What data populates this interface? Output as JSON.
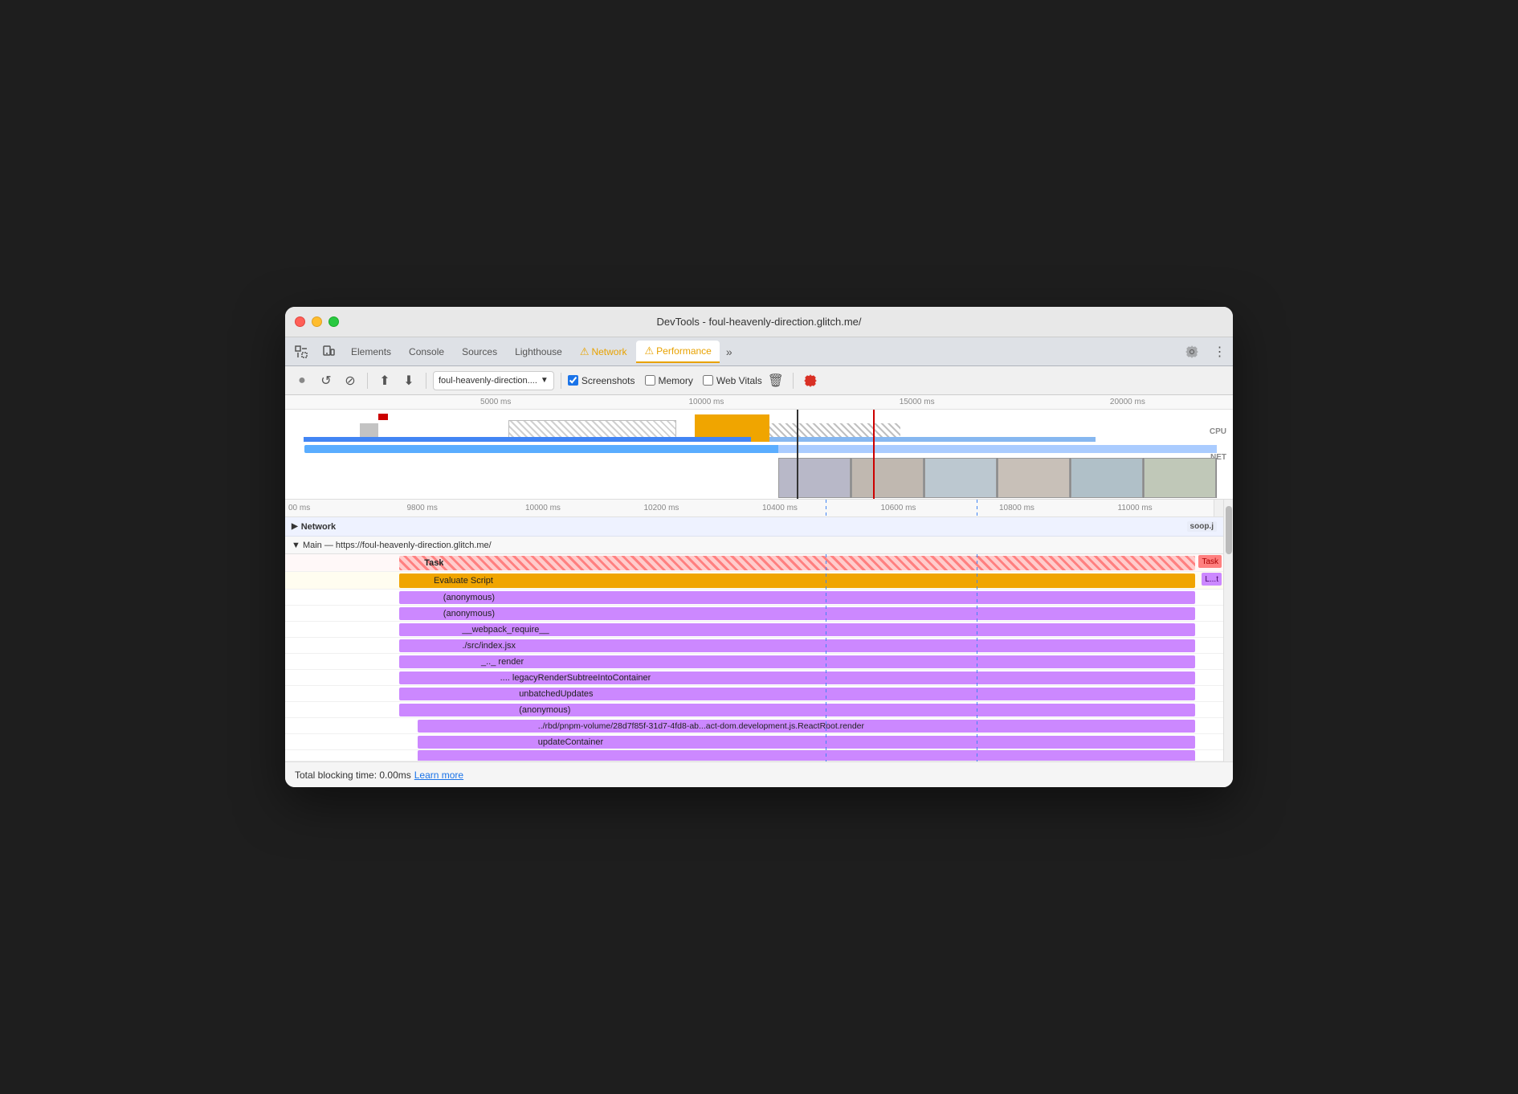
{
  "window": {
    "title": "DevTools - foul-heavenly-direction.glitch.me/"
  },
  "tabs": [
    {
      "id": "inspect",
      "label": "▢",
      "icon": "inspect-icon",
      "active": false
    },
    {
      "id": "device",
      "label": "⬚",
      "icon": "device-icon",
      "active": false
    },
    {
      "id": "elements",
      "label": "Elements",
      "active": false
    },
    {
      "id": "console",
      "label": "Console",
      "active": false
    },
    {
      "id": "sources",
      "label": "Sources",
      "active": false
    },
    {
      "id": "lighthouse",
      "label": "Lighthouse",
      "active": false,
      "warning": false
    },
    {
      "id": "network",
      "label": "Network",
      "active": false,
      "warning": true
    },
    {
      "id": "performance",
      "label": "Performance",
      "active": true,
      "warning": true
    },
    {
      "id": "more",
      "label": "»",
      "active": false
    }
  ],
  "toolbar": {
    "record_label": "●",
    "reload_label": "↺",
    "clear_label": "⊘",
    "upload_label": "↑",
    "download_label": "↓",
    "url_value": "foul-heavenly-direction....",
    "screenshots_label": "Screenshots",
    "memory_label": "Memory",
    "webvitals_label": "Web Vitals",
    "trash_label": "🗑",
    "settings_label": "⚙"
  },
  "ruler_top": {
    "marks": [
      "5000 ms",
      "10000 ms",
      "15000 ms",
      "20000 ms"
    ]
  },
  "labels": {
    "cpu": "CPU",
    "net": "NET"
  },
  "detail_ruler": {
    "marks": [
      "00 ms",
      "9800 ms",
      "10000 ms",
      "10200 ms",
      "10400 ms",
      "10600 ms",
      "10800 ms",
      "11000 ms"
    ]
  },
  "sections": {
    "network": {
      "label": "Network",
      "badge": "soop.j"
    },
    "main": {
      "label": "▼ Main — https://foul-heavenly-direction.glitch.me/"
    }
  },
  "flame_rows": [
    {
      "label": "Task",
      "badge": "Task",
      "badge_type": "task",
      "depth": 0,
      "color": "task",
      "left_pct": 12,
      "width_pct": 85
    },
    {
      "label": "Evaluate Script",
      "badge": "L...t",
      "badge_type": "lt",
      "depth": 1,
      "color": "eval",
      "left_pct": 12,
      "width_pct": 85
    },
    {
      "label": "(anonymous)",
      "depth": 2,
      "color": "anon",
      "left_pct": 12,
      "width_pct": 84
    },
    {
      "label": "(anonymous)",
      "depth": 2,
      "color": "anon",
      "left_pct": 12,
      "width_pct": 84
    },
    {
      "label": "__webpack_require__",
      "depth": 3,
      "color": "anon",
      "left_pct": 12,
      "width_pct": 84
    },
    {
      "label": "./src/index.jsx",
      "depth": 3,
      "color": "anon",
      "left_pct": 12,
      "width_pct": 84
    },
    {
      "label": "_.._  render",
      "depth": 4,
      "color": "anon",
      "left_pct": 12,
      "width_pct": 84
    },
    {
      "label": "....  legacyRenderSubtreeIntoContainer",
      "depth": 5,
      "color": "anon",
      "left_pct": 12,
      "width_pct": 84
    },
    {
      "label": "unbatchedUpdates",
      "depth": 6,
      "color": "anon",
      "left_pct": 12,
      "width_pct": 84
    },
    {
      "label": "(anonymous)",
      "depth": 6,
      "color": "anon",
      "left_pct": 12,
      "width_pct": 84
    },
    {
      "label": "../rbd/pnpm-volume/28d7f85f-31d7-4fd8-ab...act-dom.development.js.ReactRoot.render",
      "depth": 7,
      "color": "anon",
      "left_pct": 14,
      "width_pct": 82
    },
    {
      "label": "updateContainer",
      "depth": 7,
      "color": "anon",
      "left_pct": 14,
      "width_pct": 82
    }
  ],
  "status_bar": {
    "text": "Total blocking time: 0.00ms",
    "learn_more": "Learn more"
  },
  "colors": {
    "accent_blue": "#1a73e8",
    "warning_yellow": "#e8a200",
    "task_red": "#ff8080",
    "eval_gold": "#f0a500",
    "anon_purple": "#cc88ff",
    "net_blue": "#d0e8ff",
    "selection_blue": "rgba(66,133,244,0.15)"
  }
}
